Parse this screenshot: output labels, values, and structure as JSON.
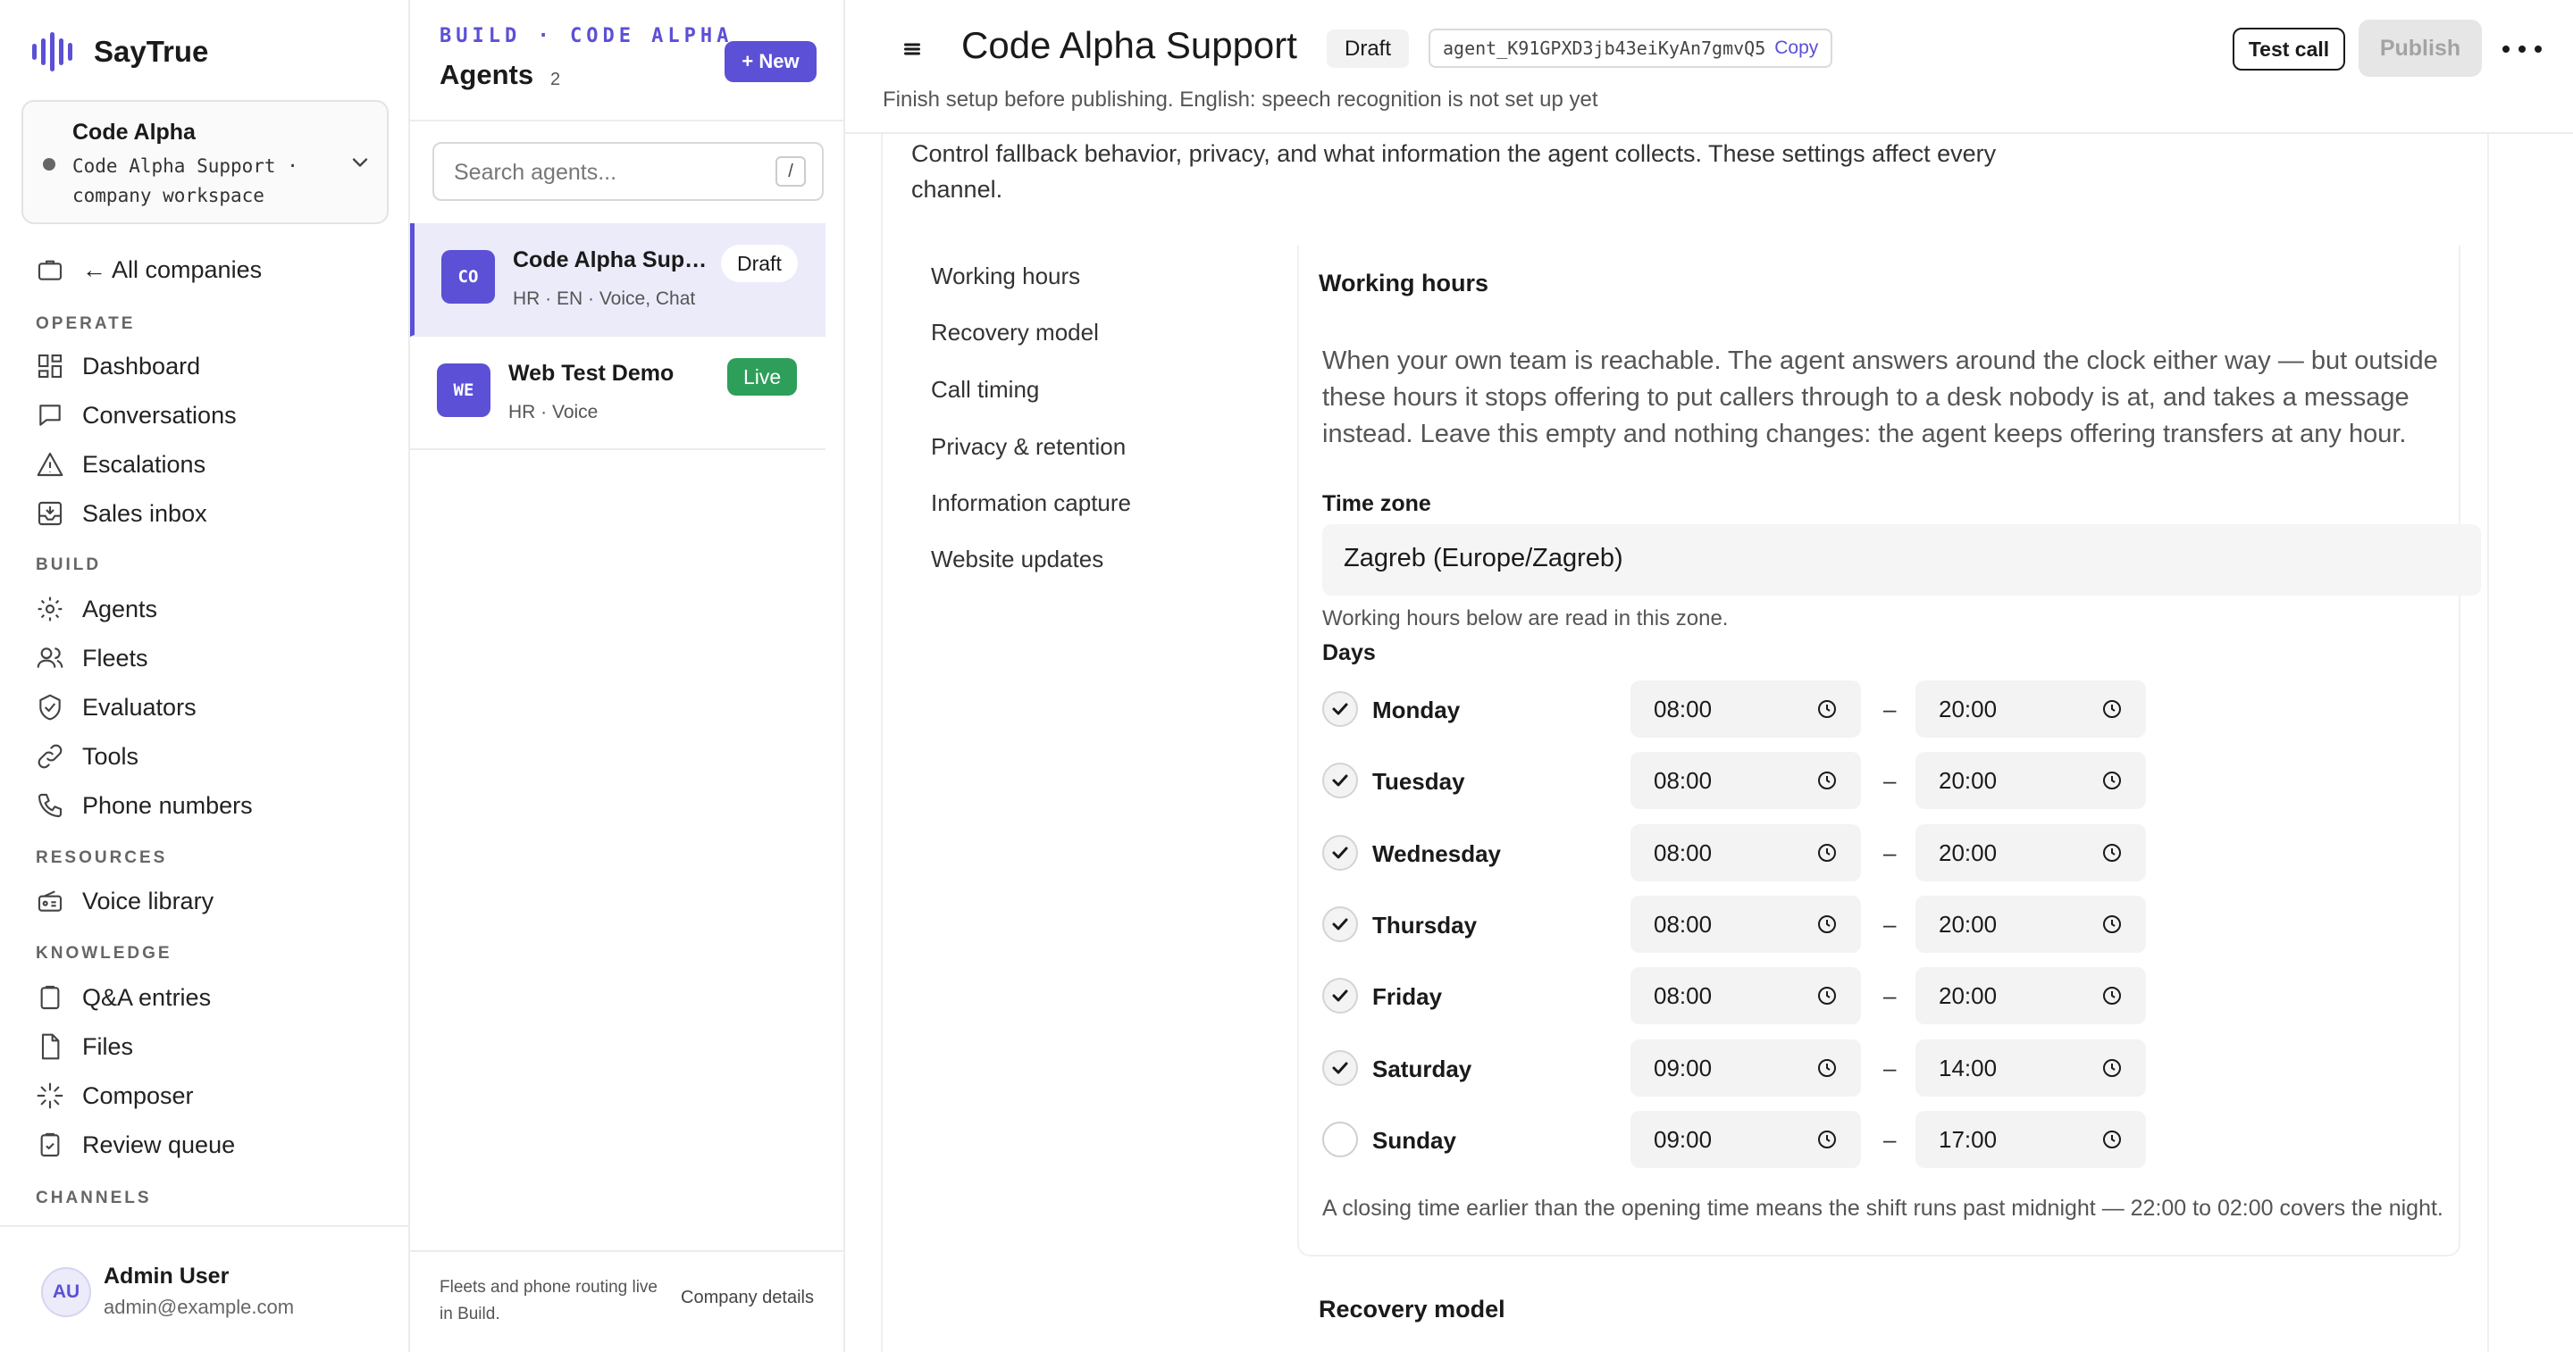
{
  "brand": {
    "name": "SayTrue"
  },
  "workspace": {
    "title": "Code Alpha",
    "subtitle": "Code Alpha Support · company workspace"
  },
  "nav": {
    "all_companies": "← All companies",
    "sections": {
      "operate": "OPERATE",
      "build": "BUILD",
      "resources": "RESOURCES",
      "knowledge": "KNOWLEDGE",
      "channels": "CHANNELS"
    },
    "items": {
      "dashboard": "Dashboard",
      "conversations": "Conversations",
      "escalations": "Escalations",
      "sales_inbox": "Sales inbox",
      "agents": "Agents",
      "fleets": "Fleets",
      "evaluators": "Evaluators",
      "tools": "Tools",
      "phone_numbers": "Phone numbers",
      "voice_library": "Voice library",
      "qa_entries": "Q&A entries",
      "files": "Files",
      "composer": "Composer",
      "review_queue": "Review queue"
    }
  },
  "user": {
    "initials": "AU",
    "name": "Admin User",
    "email": "admin@example.com"
  },
  "agents_panel": {
    "breadcrumb": "BUILD · CODE ALPHA",
    "title": "Agents",
    "count": "2",
    "new_label": "+ New",
    "search_placeholder": "Search agents...",
    "search_shortcut": "/",
    "list": [
      {
        "initials": "CO",
        "name": "Code Alpha Supp...",
        "meta": "HR · EN · Voice, Chat",
        "status": "Draft"
      },
      {
        "initials": "WE",
        "name": "Web Test Demo",
        "meta": "HR · Voice",
        "status": "Live"
      }
    ],
    "footer_note": "Fleets and phone routing live in Build.",
    "footer_link": "Company details"
  },
  "header": {
    "title": "Code Alpha Support",
    "status": "Draft",
    "agent_id": "agent_K91GPXD3jb43eiKyAn7gmvQ5",
    "copy_label": "Copy",
    "setup_note": "Finish setup before publishing. English: speech recognition is not set up yet",
    "test_call_label": "Test call",
    "publish_label": "Publish"
  },
  "intro": "Control fallback behavior, privacy, and what information the agent collects. These settings affect every channel.",
  "subnav": [
    "Working hours",
    "Recovery model",
    "Call timing",
    "Privacy & retention",
    "Information capture",
    "Website updates"
  ],
  "working_hours": {
    "title": "Working hours",
    "description": "When your own team is reachable. The agent answers around the clock either way — but outside these hours it stops offering to put callers through to a desk nobody is at, and takes a message instead. Leave this empty and nothing changes: the agent keeps offering transfers at any hour.",
    "timezone_label": "Time zone",
    "timezone_value": "Zagreb (Europe/Zagreb)",
    "timezone_hint": "Working hours below are read in this zone.",
    "days_label": "Days",
    "separator": "–",
    "days": [
      {
        "name": "Monday",
        "enabled": true,
        "open": "08:00",
        "close": "20:00"
      },
      {
        "name": "Tuesday",
        "enabled": true,
        "open": "08:00",
        "close": "20:00"
      },
      {
        "name": "Wednesday",
        "enabled": true,
        "open": "08:00",
        "close": "20:00"
      },
      {
        "name": "Thursday",
        "enabled": true,
        "open": "08:00",
        "close": "20:00"
      },
      {
        "name": "Friday",
        "enabled": true,
        "open": "08:00",
        "close": "20:00"
      },
      {
        "name": "Saturday",
        "enabled": true,
        "open": "09:00",
        "close": "14:00"
      },
      {
        "name": "Sunday",
        "enabled": false,
        "open": "09:00",
        "close": "17:00"
      }
    ],
    "night_note": "A closing time earlier than the opening time means the shift runs past midnight — 22:00 to 02:00 covers the night."
  },
  "next_section_title": "Recovery model",
  "colors": {
    "accent": "#5b50d6",
    "live": "#2e9f5a",
    "active_row": "#ecebfa"
  }
}
